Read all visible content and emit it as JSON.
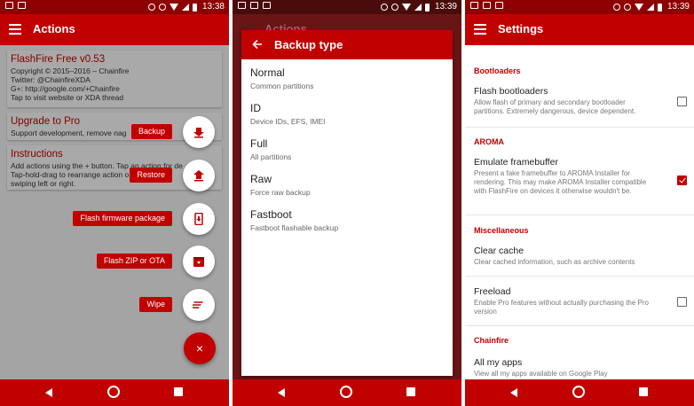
{
  "panel1": {
    "status_time": "13:38",
    "title": "Actions",
    "cards": {
      "info": {
        "title": "FlashFire Free v0.53",
        "lines": [
          "Copyright © 2015–2016 – Chainfire",
          "Twitter: @ChainfireXDA",
          "G+: http://google.com/+Chainfire",
          "Tap to visit website or XDA thread"
        ]
      },
      "upgrade": {
        "title": "Upgrade to Pro",
        "lines": [
          "Support development, remove nag"
        ]
      },
      "instructions": {
        "title": "Instructions",
        "lines": [
          "Add actions using the + button. Tap an action for de",
          "Tap-hold-drag to rearrange action o",
          "swiping left or right."
        ]
      }
    },
    "fab_actions": {
      "backup": "Backup",
      "restore": "Restore",
      "flash_firmware": "Flash firmware package",
      "flash_zip": "Flash ZIP or OTA",
      "wipe": "Wipe"
    },
    "fab_close": "×"
  },
  "panel2": {
    "status_time": "13:39",
    "behind_title": "Actions",
    "dialog_title": "Backup type",
    "options": [
      {
        "title": "Normal",
        "subtitle": "Common partitions"
      },
      {
        "title": "ID",
        "subtitle": "Device IDs, EFS, IMEI"
      },
      {
        "title": "Full",
        "subtitle": "All partitions"
      },
      {
        "title": "Raw",
        "subtitle": "Force raw backup"
      },
      {
        "title": "Fastboot",
        "subtitle": "Fastboot flashable backup"
      }
    ]
  },
  "panel3": {
    "status_time": "13:39",
    "title": "Settings",
    "sections": {
      "bootloaders": "Bootloaders",
      "aroma": "AROMA",
      "misc": "Miscellaneous",
      "chainfire": "Chainfire"
    },
    "prefs": {
      "flash_bootloaders": {
        "title": "Flash bootloaders",
        "subtitle": "Allow flash of primary and secondary bootloader partitions. Extremely dangerous, device dependent.",
        "checked": false
      },
      "emulate_framebuffer": {
        "title": "Emulate framebuffer",
        "subtitle": "Present a fake framebuffer to AROMA Installer for rendering. This may make AROMA Installer compatible with FlashFire on devices it otherwise wouldn't be.",
        "checked": true
      },
      "clear_cache": {
        "title": "Clear cache",
        "subtitle": "Clear cached information, such as archive contents"
      },
      "freeload": {
        "title": "Freeload",
        "subtitle": "Enable Pro features without actually purchasing the Pro version",
        "checked": false
      },
      "all_my_apps": {
        "title": "All my apps",
        "subtitle": "View all my apps available on Google Play"
      }
    }
  },
  "colors": {
    "primary": "#c10000",
    "status_bar": "#8e0000",
    "surface": "#ffffff"
  }
}
